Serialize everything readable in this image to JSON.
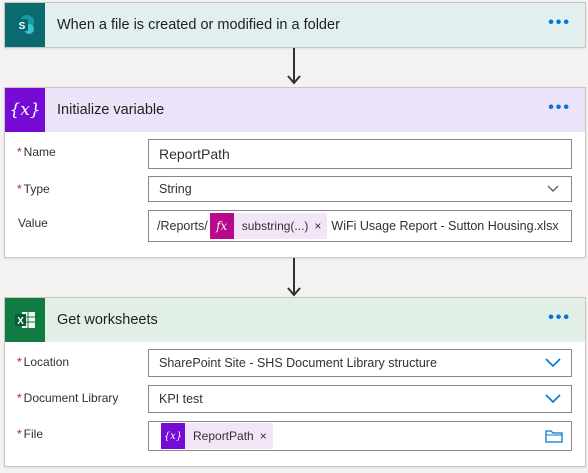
{
  "trigger": {
    "title": "When a file is created or modified in a folder",
    "more_label": "•••",
    "icon_letter": "S",
    "color": "#0b6a6f",
    "header_bg": "#e2efef"
  },
  "init_variable": {
    "title": "Initialize variable",
    "more_label": "•••",
    "icon_glyph": "{x}",
    "color": "#770bd6",
    "header_bg": "#ede3f8",
    "fields": {
      "name": {
        "label": "Name",
        "required_mark": "*",
        "value": "ReportPath"
      },
      "type": {
        "label": "Type",
        "required_mark": "*",
        "value": "String"
      },
      "value": {
        "label": "Value",
        "prefix": "/Reports/",
        "token_label": "substring(...)",
        "token_icon": "fx",
        "token_remove": "×",
        "suffix": "WiFi Usage Report - Sutton Housing.xlsx"
      }
    }
  },
  "get_worksheets": {
    "title": "Get worksheets",
    "more_label": "•••",
    "icon_letter": "X",
    "color": "#107c41",
    "header_bg": "#e1efe7",
    "fields": {
      "location": {
        "label": "Location",
        "required_mark": "*",
        "value": "SharePoint Site - SHS Document Library structure"
      },
      "library": {
        "label": "Document Library",
        "required_mark": "*",
        "value": "KPI test"
      },
      "file": {
        "label": "File",
        "required_mark": "*",
        "token_label": "ReportPath",
        "token_icon": "{x}",
        "token_remove": "×"
      }
    }
  }
}
